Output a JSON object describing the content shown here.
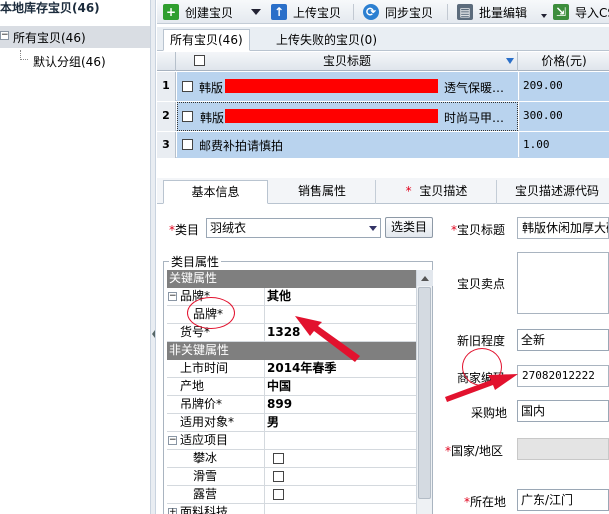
{
  "left": {
    "title": "本地库存宝贝(46)",
    "tree_all": "所有宝贝(46)",
    "tree_default": "默认分组(46)"
  },
  "toolbar": {
    "create": "创建宝贝",
    "upload": "上传宝贝",
    "sync": "同步宝贝",
    "batch_edit": "批量编辑",
    "import": "导入CS"
  },
  "tabs": {
    "all": "所有宝贝(46)",
    "failed": "上传失败的宝贝(0)"
  },
  "grid": {
    "col_title": "宝贝标题",
    "col_price": "价格(元)",
    "rows": [
      {
        "num": "1",
        "title_prefix": "韩版",
        "title_suffix": "透气保暖…",
        "price": "209.00"
      },
      {
        "num": "2",
        "title_prefix": "韩版",
        "title_suffix": "时尚马甲…",
        "price": "300.00"
      },
      {
        "num": "3",
        "title_prefix": "邮费补拍请慎拍",
        "title_suffix": "",
        "price": "1.00"
      }
    ]
  },
  "lower_tabs": {
    "basic": "基本信息",
    "sales": "销售属性",
    "desc": "宝贝描述",
    "desc_src": "宝贝描述源代码"
  },
  "form": {
    "category_label": "类目",
    "category_value": "羽绒衣",
    "choose_category": "选类目",
    "attr_legend": "类目属性",
    "key_attrs": "关键属性",
    "brand_label": "品牌*",
    "brand_value": "其他",
    "brand_sub_label": "品牌*",
    "item_no_label": "货号*",
    "item_no_value": "1328",
    "nonkey_attrs": "非关键属性",
    "launch_label": "上市时间",
    "launch_value": "2014年春季",
    "origin_label": "产地",
    "origin_value": "中国",
    "tag_price_label": "吊牌价*",
    "tag_price_value": "899",
    "target_label": "适用对象*",
    "target_value": "男",
    "usage_label": "适应项目",
    "usage_1": "攀冰",
    "usage_2": "滑雪",
    "usage_3": "露营",
    "fabric_label": "面料科技",
    "title_label": "宝贝标题",
    "title_value": "韩版休闲加厚大码",
    "selling_label": "宝贝卖点",
    "condition_label": "新旧程度",
    "condition_value": "全新",
    "merchant_code_label": "商家编码",
    "merchant_code_value": "27082012222",
    "purchase_label": "采购地",
    "purchase_value": "国内",
    "country_label": "国家/地区",
    "location_label": "所在地",
    "location_value": "广东/江门"
  }
}
